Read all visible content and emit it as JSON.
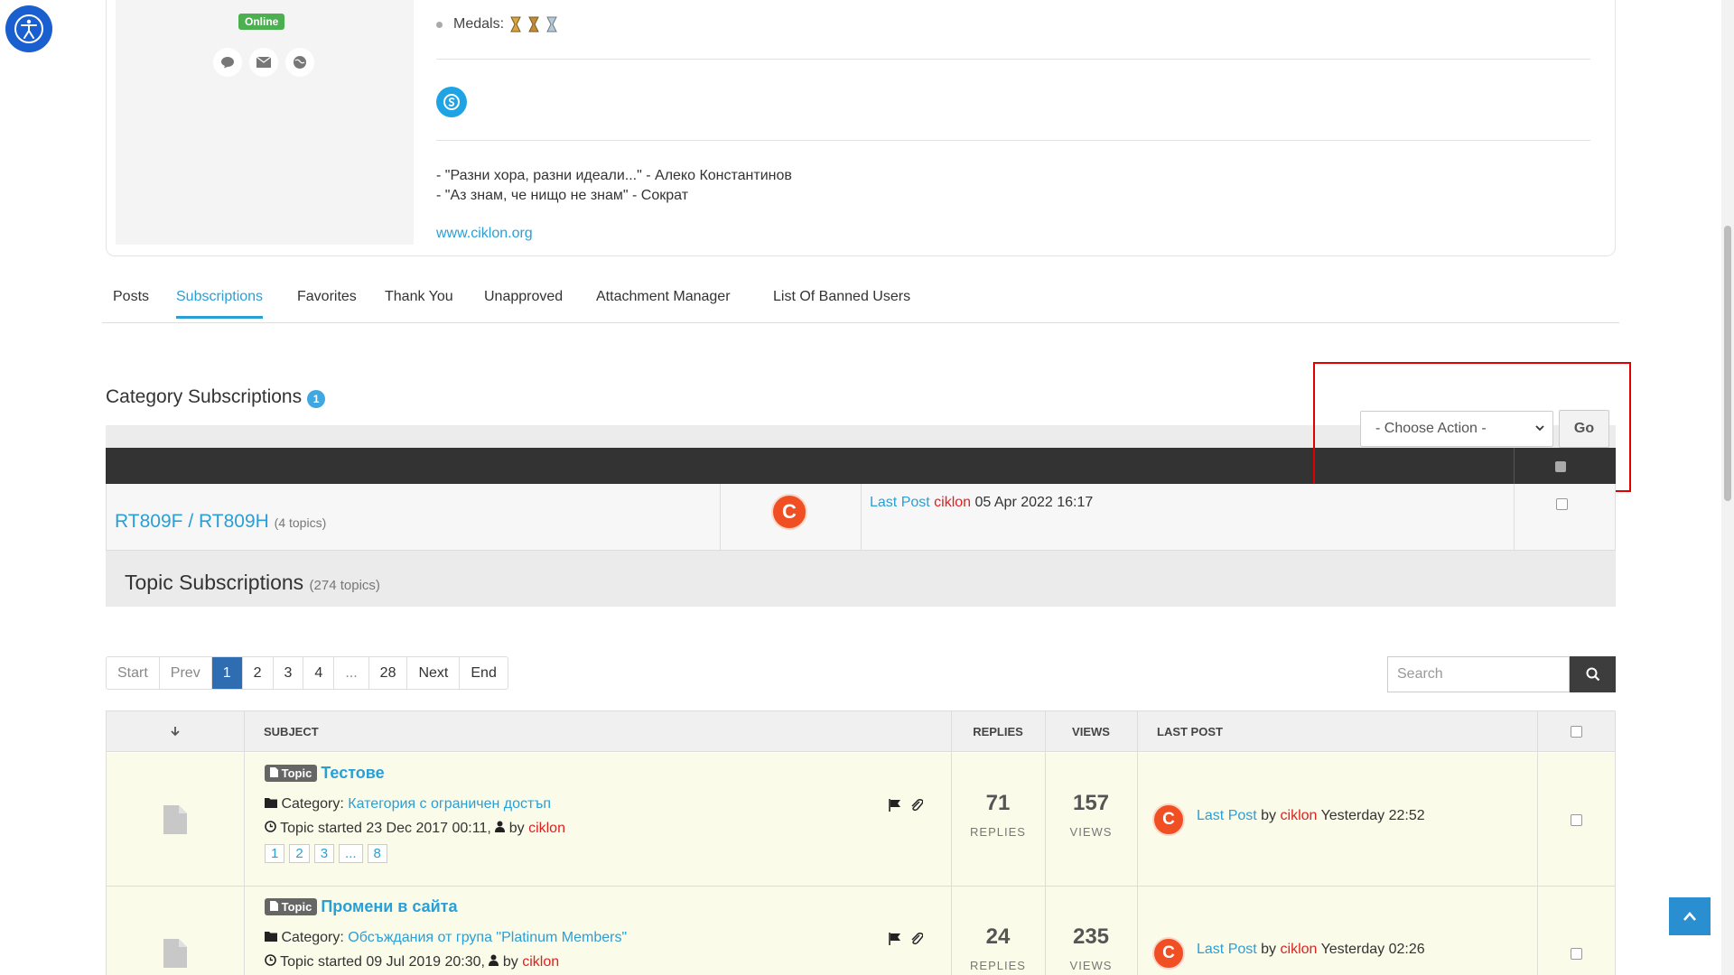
{
  "profile": {
    "status_badge": "Online",
    "medals_label": "Medals:",
    "signature_lines": [
      "- \"Разни хора, разни идеали...\" - Алеко Константинов",
      "- \"Аз знам, че нищо не знам\" - Сократ"
    ],
    "website": "www.ciklon.org"
  },
  "tabs": [
    {
      "label": "Posts"
    },
    {
      "label": "Subscriptions"
    },
    {
      "label": "Favorites"
    },
    {
      "label": "Thank You"
    },
    {
      "label": "Unapproved"
    },
    {
      "label": "Attachment Manager"
    },
    {
      "label": "List Of Banned Users"
    }
  ],
  "category_subscriptions": {
    "title": "Category Subscriptions",
    "count": "1",
    "action_select": "- Choose Action -",
    "go_label": "Go",
    "rows": [
      {
        "name": "RT809F / RT809H",
        "topics": "(4 topics)",
        "avatar_letter": "C",
        "last_post_label": "Last Post",
        "last_post_user": "ciklon",
        "last_post_date": "05 Apr 2022 16:17"
      }
    ]
  },
  "topic_subscriptions": {
    "title": "Topic Subscriptions",
    "count_text": "(274 topics)"
  },
  "pagination": [
    "Start",
    "Prev",
    "1",
    "2",
    "3",
    "4",
    "...",
    "28",
    "Next",
    "End"
  ],
  "search": {
    "placeholder": "Search"
  },
  "topics_table": {
    "headers": {
      "subject": "SUBJECT",
      "replies": "REPLIES",
      "views": "VIEWS",
      "last_post": "LAST POST"
    },
    "rows": [
      {
        "tag": "Topic",
        "title": "Тестове",
        "category_label": "Category:",
        "category": "Категория с ограничен достъп",
        "started": "Topic started 23 Dec 2017 00:11,",
        "by_label": "by",
        "author": "ciklon",
        "pages": [
          "1",
          "2",
          "3",
          "...",
          "8"
        ],
        "replies": "71",
        "replies_label": "REPLIES",
        "views": "157",
        "views_label": "VIEWS",
        "last_post_label": "Last Post",
        "last_by": "by",
        "last_user": "ciklon",
        "last_date": "Yesterday 22:52"
      },
      {
        "tag": "Topic",
        "title": "Промени в сайта",
        "category_label": "Category:",
        "category": "Обсъждания от група \"Platinum Members\"",
        "started": "Topic started 09 Jul 2019 20:30,",
        "by_label": "by",
        "author": "ciklon",
        "replies": "24",
        "replies_label": "REPLIES",
        "views": "235",
        "views_label": "VIEWS",
        "last_post_label": "Last Post",
        "last_by": "by",
        "last_user": "ciklon",
        "last_date": "Yesterday 02:26"
      }
    ]
  },
  "colors": {
    "accent": "#2a9fd6",
    "author": "#e02020",
    "highlight_box": "#e00000",
    "dark_header": "#333333"
  }
}
